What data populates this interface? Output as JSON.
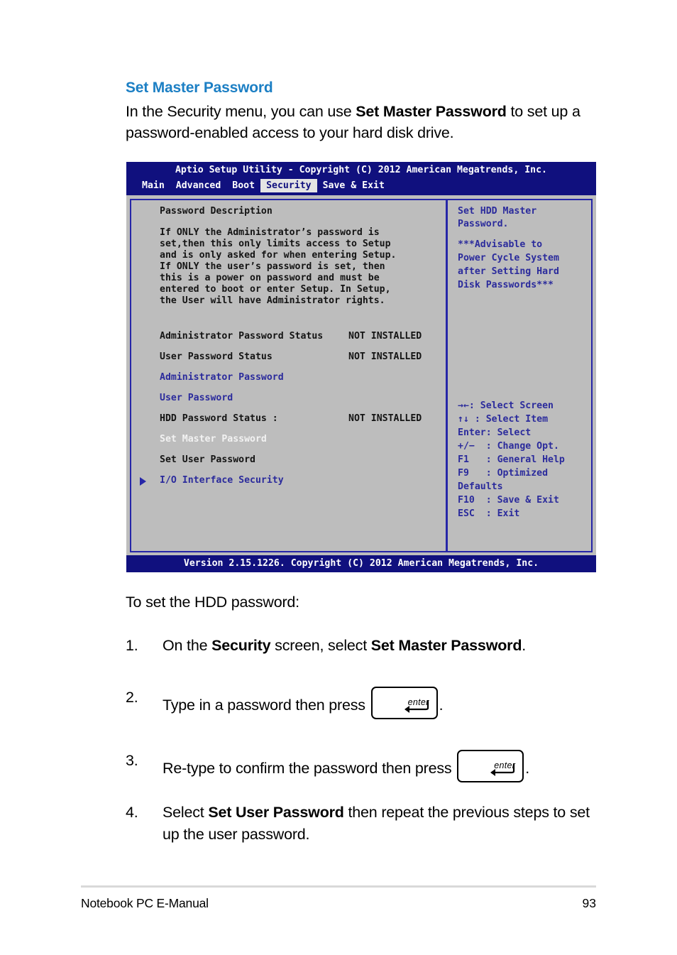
{
  "section": {
    "title": "Set Master Password",
    "intro_plain": "In the Security menu, you can use Set Master Password to set up a password-enabled access to your hard disk drive.",
    "intro_part1": "In the Security menu, you can use ",
    "intro_bold": "Set Master Password",
    "intro_part2": " to set up a password-enabled access to your hard disk drive."
  },
  "bios": {
    "title": "Aptio Setup Utility - Copyright (C) 2012 American Megatrends, Inc.",
    "menu": [
      {
        "label": "Main",
        "active": false
      },
      {
        "label": "Advanced",
        "active": false
      },
      {
        "label": "Boot",
        "active": false
      },
      {
        "label": "Security",
        "active": true
      },
      {
        "label": "Save & Exit",
        "active": false
      }
    ],
    "left_pane": {
      "heading": "Password Description",
      "description_lines": [
        "If ONLY the Administrator’s password is",
        "set,then this only limits access to Setup",
        "and is only asked for when entering Setup.",
        "If ONLY the user’s password is set, then",
        "this is a power on password and must be",
        "entered to boot or enter Setup. In Setup,",
        "the User will have Administrator rights."
      ],
      "items": [
        {
          "label": "Administrator Password Status",
          "value": "NOT INSTALLED",
          "style": "black",
          "marker": false
        },
        {
          "label": "User Password Status",
          "value": "NOT INSTALLED",
          "style": "black",
          "marker": false
        },
        {
          "label": "Administrator Password",
          "value": "",
          "style": "blue",
          "marker": false
        },
        {
          "label": "User Password",
          "value": "",
          "style": "blue",
          "marker": false
        },
        {
          "label": "HDD Password Status :",
          "value": "NOT INSTALLED",
          "style": "black",
          "marker": false
        },
        {
          "label": "Set Master Password",
          "value": "",
          "style": "white",
          "marker": false
        },
        {
          "label": "Set User Password",
          "value": "",
          "style": "black",
          "marker": false
        },
        {
          "label": "I/O Interface Security",
          "value": "",
          "style": "blue",
          "marker": true
        }
      ]
    },
    "right_pane": {
      "help_lines": [
        "Set HDD Master",
        "Password.",
        "",
        "***Advisable to",
        "Power Cycle System",
        "after Setting Hard",
        "Disk Passwords***"
      ],
      "legend": [
        {
          "key": "→←",
          "sep": ": ",
          "action": "Select Screen"
        },
        {
          "key": "↑↓",
          "sep": " : ",
          "action": "Select Item"
        },
        {
          "key": "Enter:",
          "sep": " ",
          "action": "Select"
        },
        {
          "key": "+/−",
          "sep": "  : ",
          "action": "Change Opt."
        },
        {
          "key": "F1",
          "sep": "   : ",
          "action": "General Help"
        },
        {
          "key": "F9",
          "sep": "   : ",
          "action": "Optimized"
        },
        {
          "key": "Defaults",
          "sep": "",
          "action": ""
        },
        {
          "key": "F10",
          "sep": "  : ",
          "action": "Save & Exit"
        },
        {
          "key": "ESC",
          "sep": "  : ",
          "action": "Exit"
        }
      ]
    },
    "footer": "Version 2.15.1226. Copyright (C) 2012 American Megatrends, Inc.",
    "colors": {
      "header_blue": "#10107e",
      "panel_gray": "#bdbdbd",
      "border_blue": "#2626a8",
      "item_blue": "#2b2b9c",
      "tab_active_bg": "#e4e4e4"
    }
  },
  "instructions": {
    "lead": "To set the HDD password:",
    "steps": [
      {
        "num": "1.",
        "text_plain": "On the Security screen, select Set Master Password.",
        "p1": "On the ",
        "b1": "Security",
        "p2": " screen, select ",
        "b2": "Set Master Password",
        "p3": "."
      },
      {
        "num": "2.",
        "text_plain": "Type in a password then press enter .",
        "p1": "Type in a password then press ",
        "key": "enter",
        "p3": "."
      },
      {
        "num": "3.",
        "text_plain": "Re-type to confirm the password then press enter .",
        "p1": "Re-type to confirm the password then press ",
        "key": "enter",
        "p3": "."
      },
      {
        "num": "4.",
        "text_plain": "Select Set User Password then repeat the previous steps to set up the user password.",
        "p1": "Select ",
        "b1": "Set User Password",
        "p2": " then repeat the previous steps to set up the user password."
      }
    ]
  },
  "page_footer": {
    "left": "Notebook PC E-Manual",
    "page_number": "93"
  }
}
